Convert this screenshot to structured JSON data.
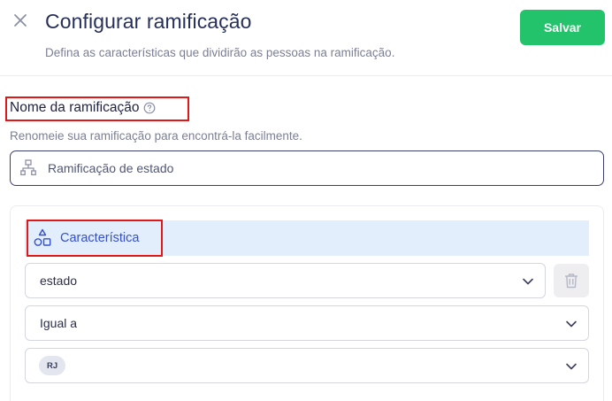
{
  "header": {
    "title": "Configurar ramificação",
    "subtitle": "Defina as características que dividirão as pessoas na ramificação.",
    "save_label": "Salvar",
    "close_icon": "close-icon"
  },
  "name_section": {
    "label": "Nome da ramificação",
    "help_icon": "help-circle-icon",
    "description": "Renomeie sua ramificação para encontrá-la facilmente.",
    "input_value": "Ramificação de estado",
    "input_icon": "branch-icon"
  },
  "characteristic": {
    "label": "Característica",
    "icon": "shapes-icon",
    "attribute_select": "estado",
    "operator_select": "Igual a",
    "value_tags": [
      "RJ"
    ],
    "delete_icon": "trash-icon"
  },
  "colors": {
    "accent_green": "#22c36a",
    "accent_blue": "#3550c8",
    "highlight_red": "#e01818"
  }
}
